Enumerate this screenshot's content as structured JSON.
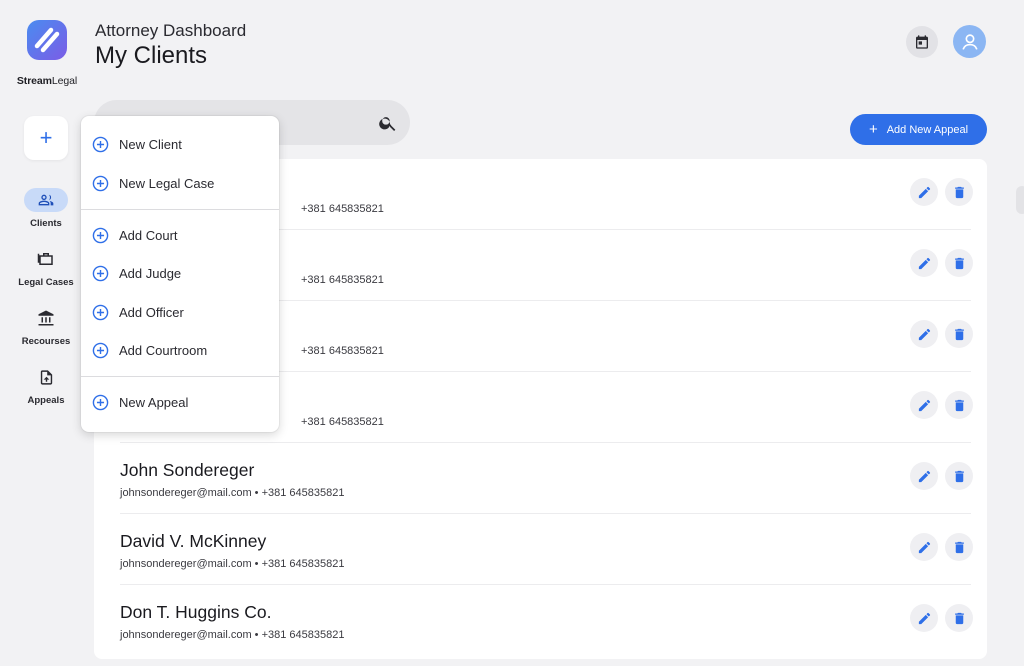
{
  "brand": {
    "name_bold": "Stream",
    "name_light": "Legal"
  },
  "header": {
    "subtitle": "Attorney Dashboard",
    "title": "My Clients"
  },
  "topbar": {
    "calendar_icon": "calendar-icon",
    "avatar_icon": "user-avatar-icon"
  },
  "sidebar": {
    "create_label": "+",
    "items": [
      {
        "label": "Clients",
        "icon": "people-icon",
        "active": true
      },
      {
        "label": "Legal Cases",
        "icon": "briefcase-icon",
        "active": false
      },
      {
        "label": "Recourses",
        "icon": "bank-icon",
        "active": false
      },
      {
        "label": "Appeals",
        "icon": "file-upload-icon",
        "active": false
      }
    ]
  },
  "search": {
    "placeholder": "",
    "value": ""
  },
  "actions": {
    "add_appeal_plus": "+",
    "add_appeal_label": "Add New Appeal"
  },
  "create_menu": {
    "items": [
      {
        "label": "New Client"
      },
      {
        "label": "New Legal Case"
      },
      {
        "label": "Add Court"
      },
      {
        "label": "Add Judge"
      },
      {
        "label": "Add Officer"
      },
      {
        "label": "Add Courtroom"
      },
      {
        "label": "New Appeal"
      }
    ]
  },
  "clients": [
    {
      "name": "",
      "meta": "+381 645835821"
    },
    {
      "name": "",
      "meta": "+381 645835821"
    },
    {
      "name": "",
      "meta": "+381 645835821"
    },
    {
      "name": "",
      "meta": "+381 645835821"
    },
    {
      "name": "John Sondereger",
      "meta": "johnsondereger@mail.com • +381 645835821"
    },
    {
      "name": "David V. McKinney",
      "meta": "johnsondereger@mail.com • +381 645835821"
    },
    {
      "name": "Don T. Huggins Co.",
      "meta": "johnsondereger@mail.com • +381 645835821"
    }
  ],
  "colors": {
    "accent": "#2f6fe8",
    "active_nav_bg": "#c8daf8",
    "background": "#f2f2f4"
  }
}
